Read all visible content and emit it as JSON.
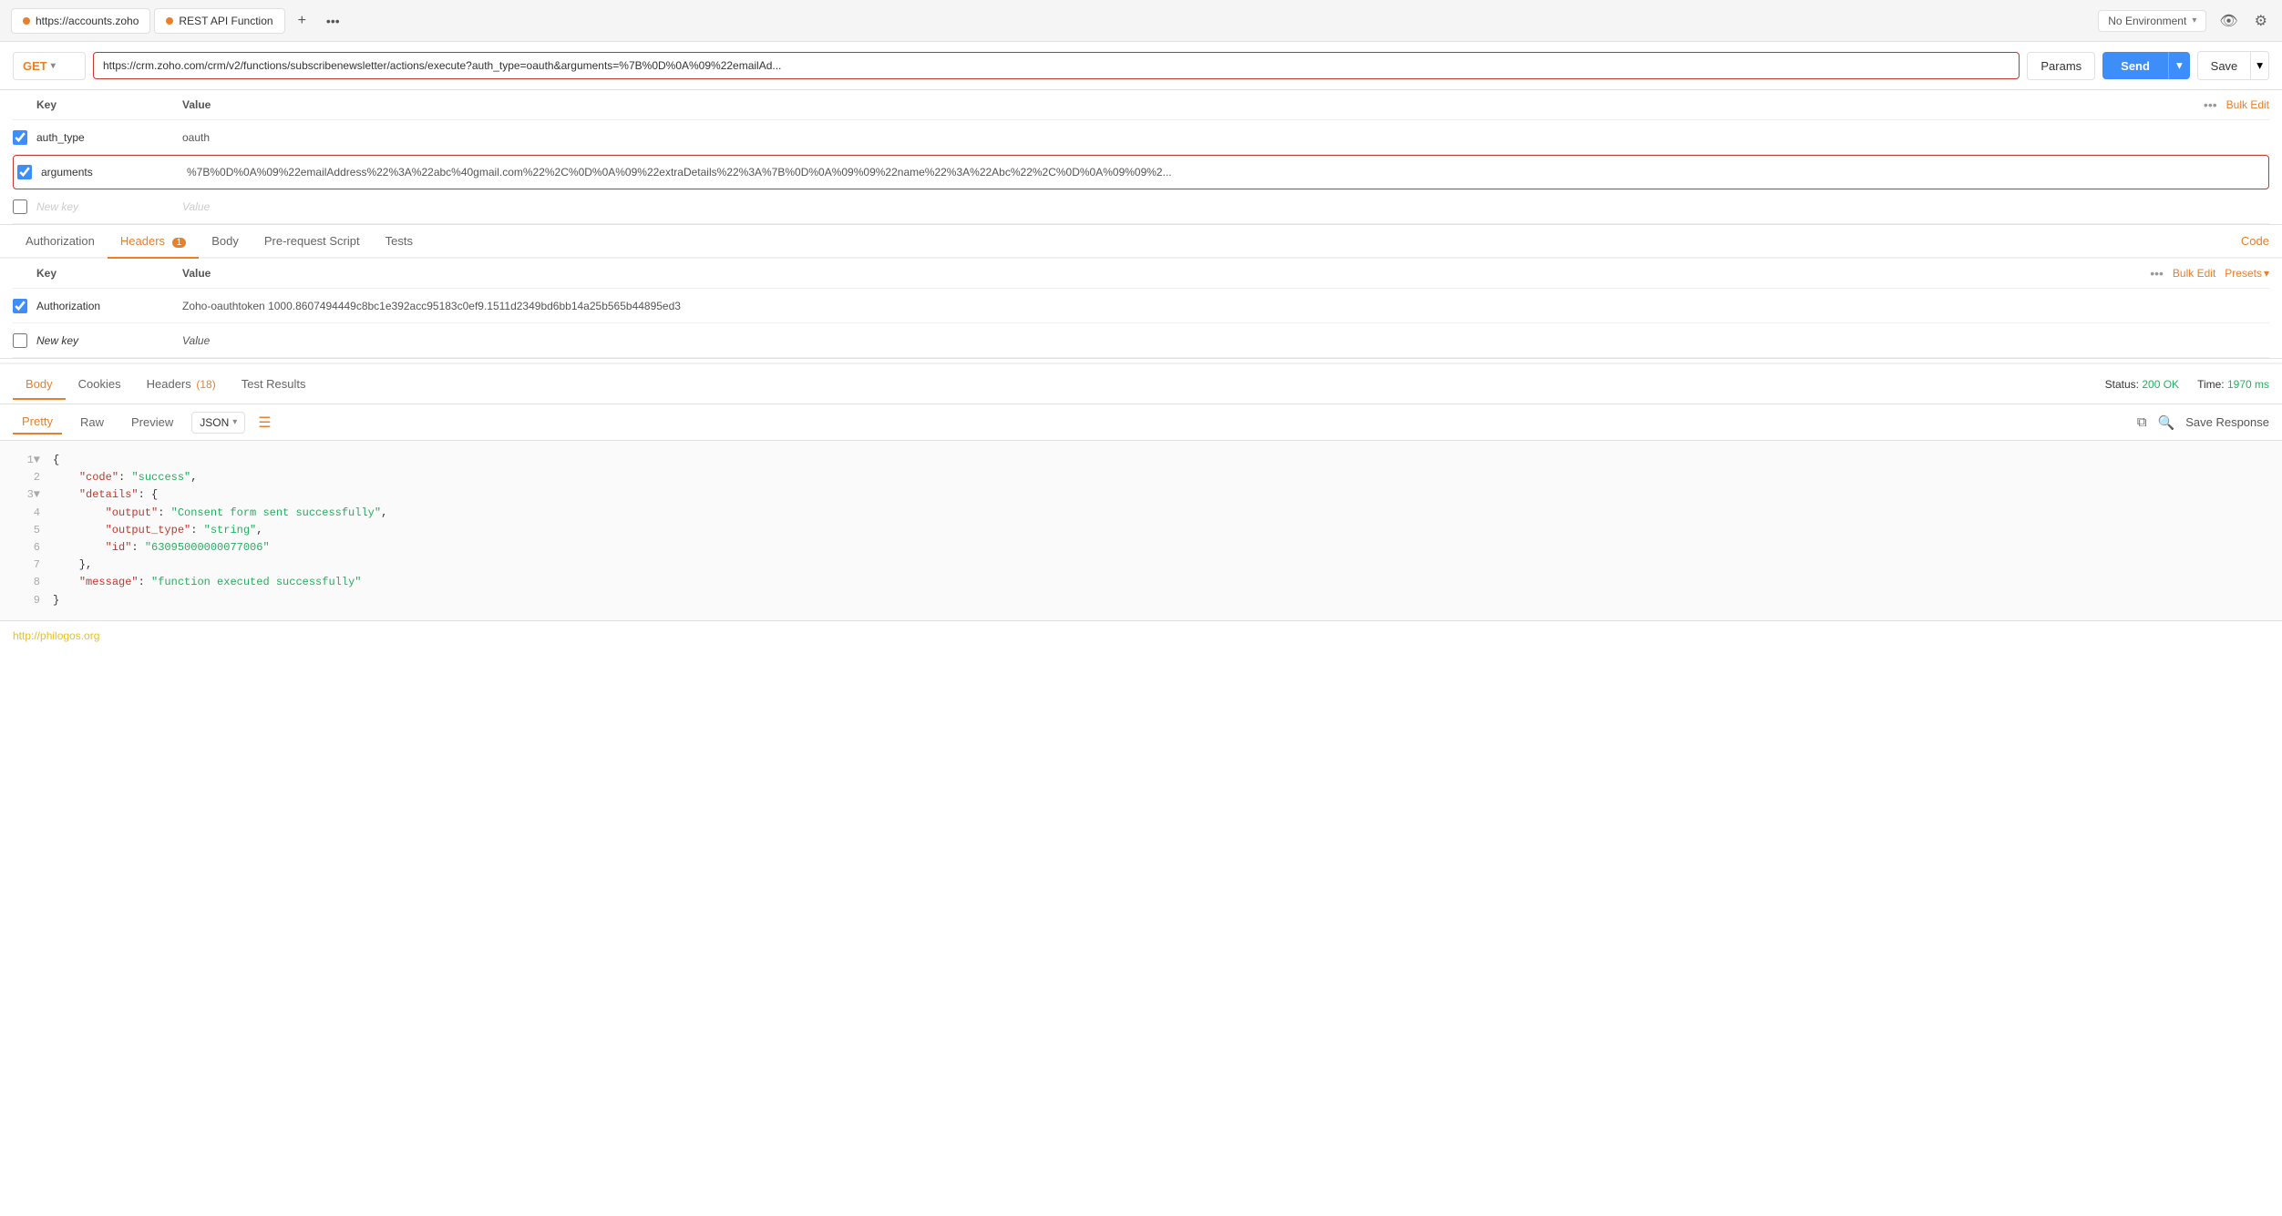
{
  "topbar": {
    "tab1_label": "https://accounts.zoho",
    "tab2_label": "REST API Function",
    "add_icon": "+",
    "more_icon": "•••",
    "env_label": "No Environment",
    "eye_icon": "👁",
    "gear_icon": "⚙"
  },
  "urlbar": {
    "method": "GET",
    "url": "https://crm.zoho.com/crm/v2/functions/subscribenewsletter/actions/execute?auth_type=oauth&arguments=%7B%0D%0A%09%22emailAd...",
    "params_label": "Params",
    "send_label": "Send",
    "save_label": "Save"
  },
  "params": {
    "col_key": "Key",
    "col_value": "Value",
    "more_icon": "•••",
    "bulk_edit_label": "Bulk Edit",
    "rows": [
      {
        "checked": true,
        "key": "auth_type",
        "value": "oauth",
        "highlighted": false
      },
      {
        "checked": true,
        "key": "arguments",
        "value": "%7B%0D%0A%09%22emailAddress%22%3A%22abc%40gmail.com%22%2C%0D%0A%09%22extraDetails%22%3A%7B%0D%0A%09%09%22name%22%3A%22Abc%22%2C%0D%0A%09%09%2...",
        "highlighted": true
      }
    ],
    "new_key_placeholder": "New key",
    "new_value_placeholder": "Value"
  },
  "request_tabs": {
    "tabs": [
      {
        "label": "Authorization",
        "active": false,
        "badge": ""
      },
      {
        "label": "Headers",
        "active": true,
        "badge": "1"
      },
      {
        "label": "Body",
        "active": false,
        "badge": ""
      },
      {
        "label": "Pre-request Script",
        "active": false,
        "badge": ""
      },
      {
        "label": "Tests",
        "active": false,
        "badge": ""
      }
    ],
    "code_label": "Code"
  },
  "headers": {
    "col_key": "Key",
    "col_value": "Value",
    "more_icon": "•••",
    "bulk_edit_label": "Bulk Edit",
    "presets_label": "Presets",
    "rows": [
      {
        "checked": true,
        "key": "Authorization",
        "value": "Zoho-oauthtoken 1000.8607494449c8bc1e392acc95183c0ef9.1511d2349bd6bb14a25b565b44895ed3"
      }
    ],
    "new_key_placeholder": "New key",
    "new_value_placeholder": "Value"
  },
  "response": {
    "tabs": [
      {
        "label": "Body",
        "active": true,
        "badge": ""
      },
      {
        "label": "Cookies",
        "active": false,
        "badge": ""
      },
      {
        "label": "Headers",
        "active": false,
        "badge": "18"
      },
      {
        "label": "Test Results",
        "active": false,
        "badge": ""
      }
    ],
    "status_label": "Status:",
    "status_value": "200 OK",
    "time_label": "Time:",
    "time_value": "1970 ms"
  },
  "response_body": {
    "tabs": [
      {
        "label": "Pretty",
        "active": true
      },
      {
        "label": "Raw",
        "active": false
      },
      {
        "label": "Preview",
        "active": false
      }
    ],
    "format_label": "JSON",
    "copy_icon": "⧉",
    "search_icon": "🔍",
    "save_response_label": "Save Response",
    "lines": [
      {
        "num": "1",
        "content": "{",
        "type": "brace",
        "collapse": "▼"
      },
      {
        "num": "2",
        "content": "\"code\": \"success\",",
        "type": "keyval"
      },
      {
        "num": "3",
        "content": "\"details\": {",
        "type": "keyobj",
        "collapse": "▼"
      },
      {
        "num": "4",
        "content": "    \"output\": \"Consent form sent successfully\",",
        "type": "keyval"
      },
      {
        "num": "5",
        "content": "    \"output_type\": \"string\",",
        "type": "keyval"
      },
      {
        "num": "6",
        "content": "    \"id\": \"63095000000077006\"",
        "type": "keyval"
      },
      {
        "num": "7",
        "content": "},",
        "type": "brace"
      },
      {
        "num": "8",
        "content": "\"message\": \"function executed successfully\"",
        "type": "keyval"
      },
      {
        "num": "9",
        "content": "}",
        "type": "brace"
      }
    ]
  },
  "footer": {
    "link_text": "http://philogos.org"
  }
}
